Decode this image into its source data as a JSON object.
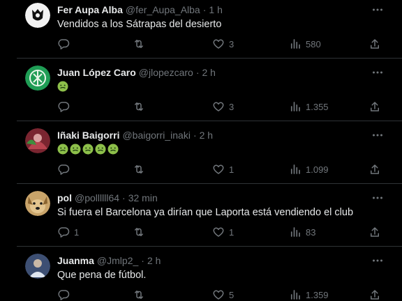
{
  "tweets": [
    {
      "name": "Fer Aupa Alba",
      "handle": "@fer_Aupa_Alba",
      "time": "1 h",
      "text": "Vendidos a los Sátrapas del desierto",
      "replies": "",
      "retweets": "",
      "likes": "3",
      "views": "580",
      "emojis": []
    },
    {
      "name": "Juan López Caro",
      "handle": "@jlopezcaro",
      "time": "2 h",
      "text": "",
      "replies": "",
      "retweets": "",
      "likes": "3",
      "views": "1.355",
      "emojis": [
        "nauseated-face"
      ]
    },
    {
      "name": "Iñaki Baigorri",
      "handle": "@baigorri_inaki",
      "time": "2 h",
      "text": "",
      "replies": "",
      "retweets": "",
      "likes": "1",
      "views": "1.099",
      "emojis": [
        "nauseated-face",
        "nauseated-face",
        "nauseated-face",
        "nauseated-face",
        "nauseated-face"
      ]
    },
    {
      "name": "pol",
      "handle": "@pollllll64",
      "time": "32 min",
      "text": "Si fuera el Barcelona ya dirían que Laporta está vendiendo el club",
      "replies": "1",
      "retweets": "",
      "likes": "1",
      "views": "83",
      "emojis": []
    },
    {
      "name": "Juanma",
      "handle": "@Jmlp2_",
      "time": "2 h",
      "text": "Que pena de fútbol.",
      "replies": "",
      "retweets": "",
      "likes": "5",
      "views": "1.359",
      "emojis": []
    }
  ],
  "separator": "·",
  "colors": {
    "background": "#000000",
    "text": "#e7e9ea",
    "muted": "#71767b",
    "border": "#2f3336",
    "emoji_green": "#8dbf4a"
  },
  "icons": [
    "reply-icon",
    "retweet-icon",
    "like-icon",
    "views-icon",
    "share-icon",
    "more-icon",
    "nauseated-face-emoji"
  ]
}
